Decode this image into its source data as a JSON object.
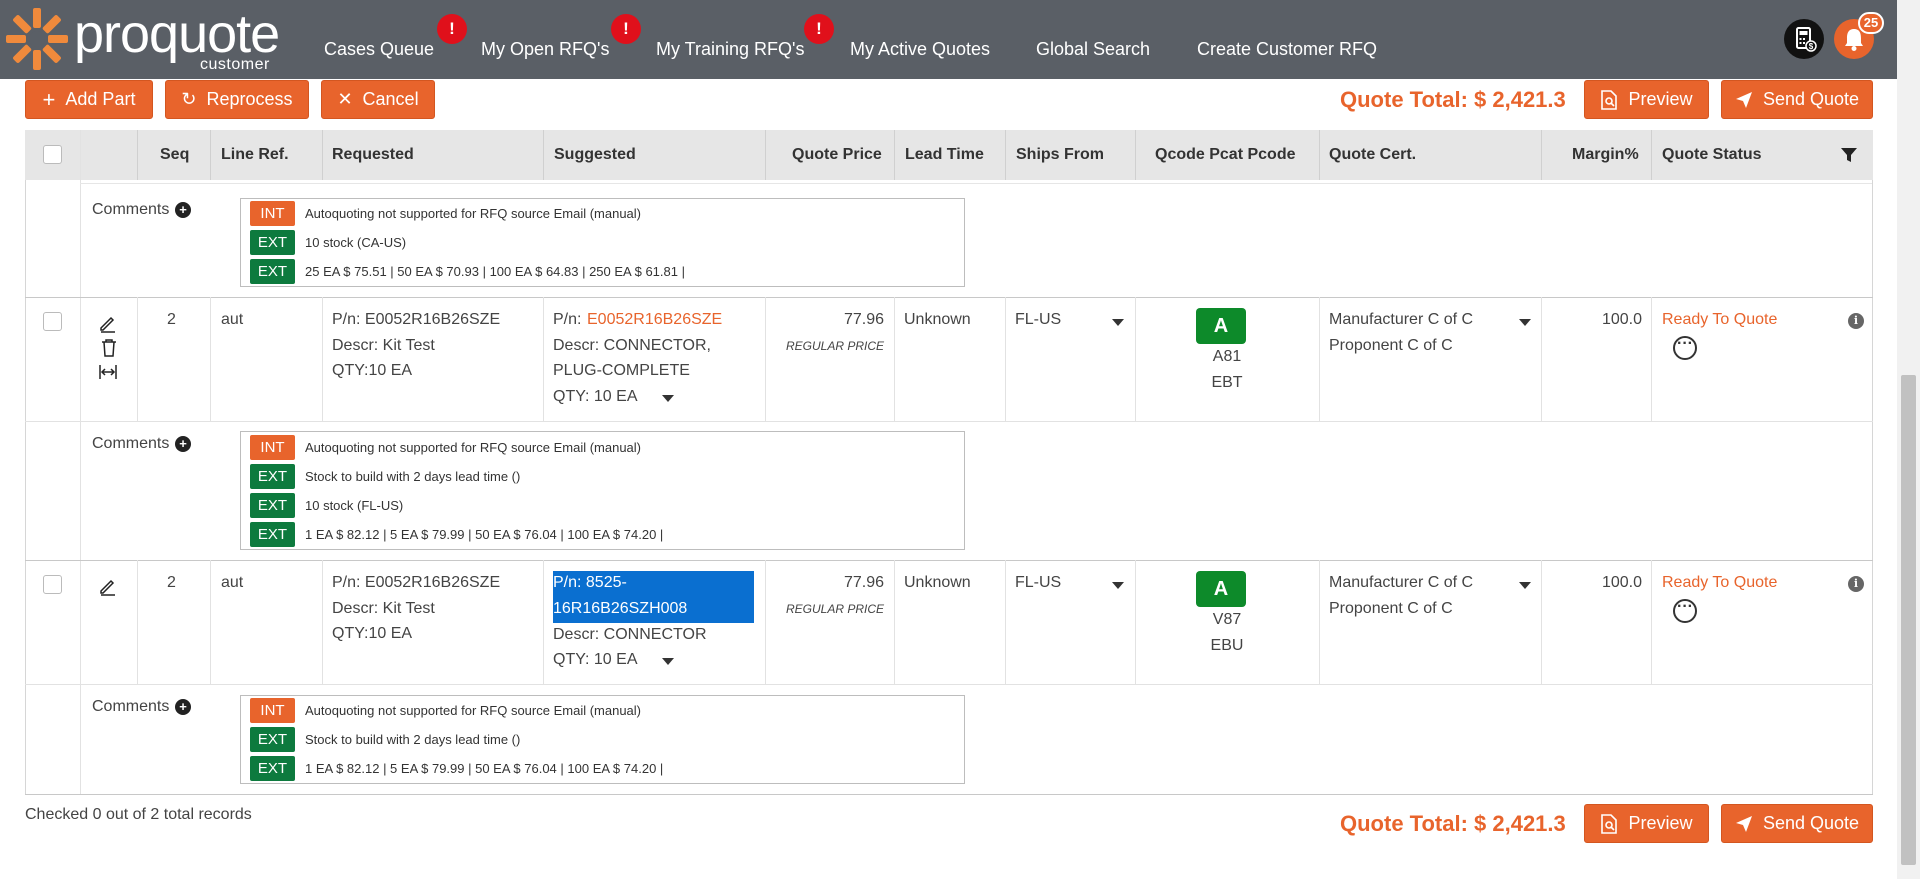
{
  "app": {
    "logo_word": "proquote",
    "logo_sub": "customer"
  },
  "nav": {
    "items": [
      {
        "label": "Cases Queue",
        "badge": "!"
      },
      {
        "label": "My Open RFQ's",
        "badge": "!"
      },
      {
        "label": "My Training RFQ's",
        "badge": "!"
      },
      {
        "label": "My Active Quotes"
      },
      {
        "label": "Global Search"
      },
      {
        "label": "Create Customer RFQ"
      }
    ],
    "notification_count": "25",
    "icons": [
      "calculator-icon",
      "bell-icon"
    ]
  },
  "toolbar": {
    "add_part": "Add Part",
    "reprocess": "Reprocess",
    "cancel": "Cancel",
    "quote_total": "Quote Total: $ 2,421.3",
    "preview": "Preview",
    "send_quote": "Send Quote"
  },
  "table": {
    "headers": [
      "Seq",
      "Line Ref.",
      "Requested",
      "Suggested",
      "Quote Price",
      "Lead Time",
      "Ships From",
      "Qcode Pcat Pcode",
      "Quote Cert.",
      "Margin%",
      "Quote Status"
    ],
    "comments_label": "Comments",
    "top_comments": [
      {
        "tag": "INT",
        "text": "Autoquoting not supported for RFQ source Email (manual)"
      },
      {
        "tag": "EXT",
        "text": "10 stock (CA-US)"
      },
      {
        "tag": "EXT",
        "text": "25 EA $ 75.51 | 50 EA $ 70.93 | 100 EA $ 64.83 | 250 EA $ 61.81 |"
      }
    ],
    "rows": [
      {
        "seq": "2",
        "line_ref": "aut",
        "req_pn": "P/n: E0052R16B26SZE",
        "req_descr": "Descr: Kit Test",
        "req_qty": "QTY:10 EA",
        "sug_pn_prefix": "P/n: ",
        "sug_pn": "E0052R16B26SZE",
        "sug_descr_1": "Descr: CONNECTOR,",
        "sug_descr_2": "PLUG-COMPLETE",
        "sug_qty": "QTY:  10  EA",
        "price": "77.96",
        "price_note": "REGULAR PRICE",
        "lead_time": "Unknown",
        "ships_from": "FL-US",
        "qcode": "A",
        "pcat": "A81",
        "pcode": "EBT",
        "cert_1": "Manufacturer C of C",
        "cert_2": "Proponent C of C",
        "margin": "100.0",
        "status": "Ready To Quote",
        "comments": [
          {
            "tag": "INT",
            "text": "Autoquoting not supported for RFQ source Email (manual)"
          },
          {
            "tag": "EXT",
            "text": "Stock to build with 2 days lead time ()"
          },
          {
            "tag": "EXT",
            "text": "10 stock (FL-US)"
          },
          {
            "tag": "EXT",
            "text": "1 EA $ 82.12 | 5 EA $ 79.99 | 50 EA $ 76.04 | 100 EA $ 74.20 |"
          }
        ]
      },
      {
        "seq": "2",
        "line_ref": "aut",
        "req_pn": "P/n: E0052R16B26SZE",
        "req_descr": "Descr: Kit Test",
        "req_qty": "QTY:10 EA",
        "sug_pn_1": "P/n: 8525-",
        "sug_pn_2": "16R16B26SZH008",
        "sug_descr_1": "Descr: CONNECTOR",
        "sug_qty": "QTY:  10  EA",
        "price": "77.96",
        "price_note": "REGULAR PRICE",
        "lead_time": "Unknown",
        "ships_from": "FL-US",
        "qcode": "A",
        "pcat": "V87",
        "pcode": "EBU",
        "cert_1": "Manufacturer C of C",
        "cert_2": "Proponent C of C",
        "margin": "100.0",
        "status": "Ready To Quote",
        "comments": [
          {
            "tag": "INT",
            "text": "Autoquoting not supported for RFQ source Email (manual)"
          },
          {
            "tag": "EXT",
            "text": "Stock to build with 2 days lead time ()"
          },
          {
            "tag": "EXT",
            "text": "1 EA $ 82.12 | 5 EA $ 79.99 | 50 EA $ 76.04 | 100 EA $ 74.20 |"
          }
        ]
      }
    ]
  },
  "footer": {
    "checked_text": "Checked 0 out of 2 total records",
    "quote_total": "Quote Total: $ 2,421.3",
    "preview": "Preview",
    "send_quote": "Send Quote"
  },
  "colors": {
    "accent": "#e8642c",
    "nav_bg": "#5a5f66",
    "ext_tag": "#0d7a3e",
    "qcode_badge": "#0d8a2a",
    "selection": "#0a6fd0"
  }
}
